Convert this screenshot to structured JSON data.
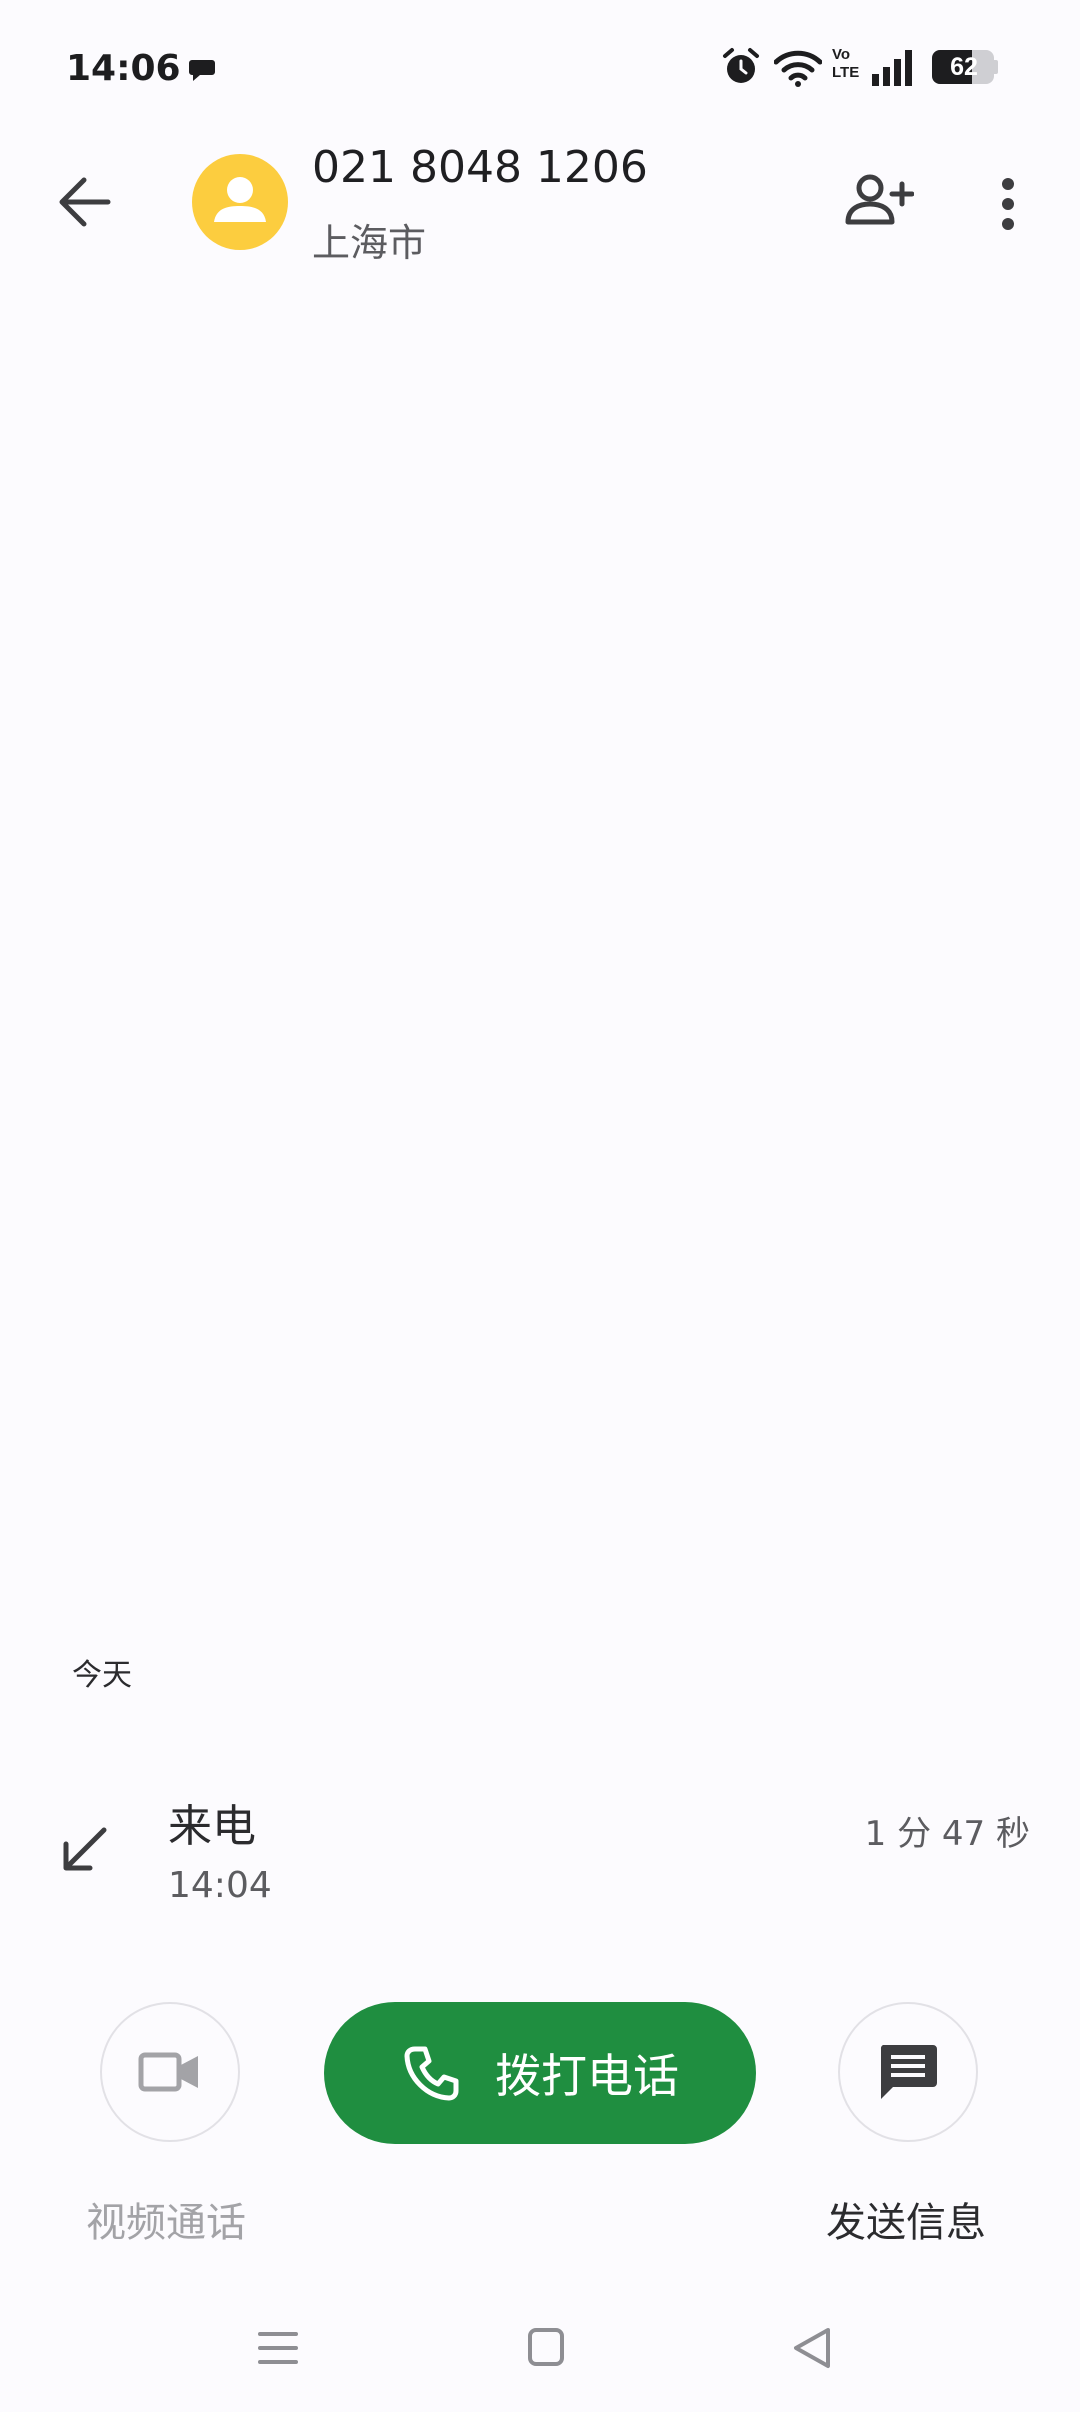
{
  "status_bar": {
    "time": "14:06",
    "battery": "62",
    "icons": [
      "message-notification-icon",
      "alarm-icon",
      "wifi-icon",
      "volte-icon",
      "signal-icon",
      "battery-icon"
    ]
  },
  "header": {
    "number": "021 8048 1206",
    "location": "上海市",
    "avatar_color": "#fccd3f"
  },
  "history": {
    "day": "今天",
    "entries": [
      {
        "type": "来电",
        "time": "14:04",
        "duration": "1 分 47 秒"
      }
    ]
  },
  "actions": {
    "video_label": "视频通话",
    "call_label": "拨打电话",
    "message_label": "发送信息",
    "call_color": "#1f8e40"
  }
}
